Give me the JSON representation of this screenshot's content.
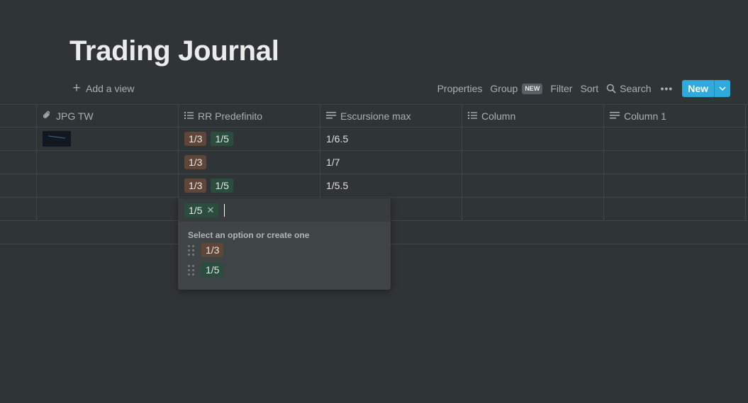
{
  "page": {
    "title": "Trading Journal"
  },
  "views": {
    "add_view_label": "Add a view"
  },
  "toolbar": {
    "properties": "Properties",
    "group": "Group",
    "group_badge": "NEW",
    "filter": "Filter",
    "sort": "Sort",
    "search": "Search",
    "more": "•••",
    "new": "New"
  },
  "columns": [
    {
      "name": "JPG TW",
      "icon": "paperclip-icon"
    },
    {
      "name": "RR Predefinito",
      "icon": "list-icon"
    },
    {
      "name": "Escursione max",
      "icon": "text-icon"
    },
    {
      "name": "Column",
      "icon": "list-icon"
    },
    {
      "name": "Column 1",
      "icon": "text-icon"
    }
  ],
  "rows": [
    {
      "has_image": true,
      "rr": [
        "1/3",
        "1/5"
      ],
      "escursione": "1/6.5"
    },
    {
      "has_image": false,
      "rr": [
        "1/3"
      ],
      "escursione": "1/7"
    },
    {
      "has_image": false,
      "rr": [
        "1/3",
        "1/5"
      ],
      "escursione": "1/5.5"
    },
    {
      "has_image": false,
      "rr": [],
      "escursione": ""
    }
  ],
  "select_popup": {
    "selected": "1/5",
    "hint": "Select an option or create one",
    "options": [
      {
        "label": "1/3",
        "color": "#5f4638"
      },
      {
        "label": "1/5",
        "color": "#2b4d3e"
      }
    ]
  },
  "colors": {
    "background": "#2f3437",
    "accent": "#2eaadc",
    "tag_brown": "#5f4638",
    "tag_green": "#2b4d3e"
  }
}
